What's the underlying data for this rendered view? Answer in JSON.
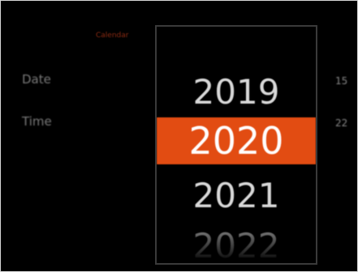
{
  "header": {
    "label": "Calendar"
  },
  "rows": {
    "date_label": "Date",
    "date_value": "15",
    "time_label": "Time",
    "time_value": "22"
  },
  "year_picker": {
    "items": [
      "2019",
      "2020",
      "2021",
      "2022"
    ],
    "selected": "2020"
  },
  "colors": {
    "accent": "#e24c12",
    "background": "#000000",
    "text": "#d8d8d8"
  }
}
